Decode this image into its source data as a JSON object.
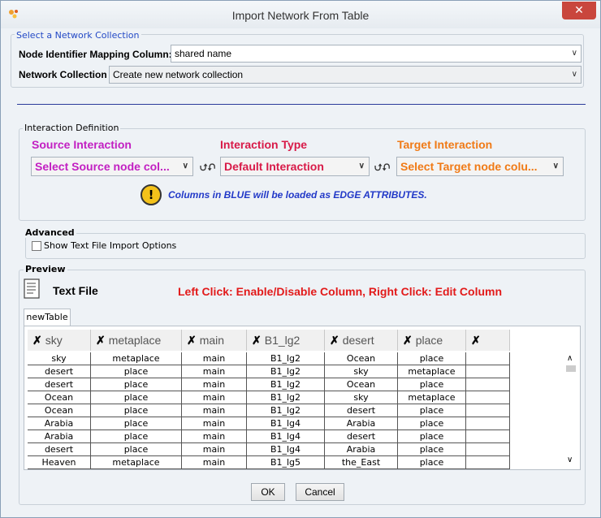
{
  "window": {
    "title": "Import Network From Table",
    "close_label": "✕"
  },
  "network_collection": {
    "legend": "Select a Network Collection",
    "node_mapping_label": "Node Identifier Mapping Column:",
    "node_mapping_value": "shared name",
    "collection_label": "Network Collection",
    "collection_value": "Create new network collection"
  },
  "interaction": {
    "legend": "Interaction Definition",
    "source_title": "Source Interaction",
    "source_value": "Select Source node col...",
    "type_title": "Interaction Type",
    "type_value": "Default Interaction",
    "target_title": "Target Interaction",
    "target_value": "Select Target node colu...",
    "warning": "Columns in BLUE will be loaded as EDGE ATTRIBUTES.",
    "colors": {
      "source": "#c21fc2",
      "type": "#d81a48",
      "target": "#f07a16"
    }
  },
  "advanced": {
    "legend": "Advanced",
    "show_options_label": "Show Text File Import Options"
  },
  "preview": {
    "legend": "Preview",
    "file_type": "Text File",
    "hint": "Left Click: Enable/Disable Column, Right Click: Edit Column",
    "tab": "newTable",
    "columns": [
      "sky",
      "metaplace",
      "main",
      "B1_lg2",
      "desert",
      "place",
      ""
    ],
    "rows": [
      [
        "sky",
        "metaplace",
        "main",
        "B1_lg2",
        "Ocean",
        "place",
        ""
      ],
      [
        "desert",
        "place",
        "main",
        "B1_lg2",
        "sky",
        "metaplace",
        ""
      ],
      [
        "desert",
        "place",
        "main",
        "B1_lg2",
        "Ocean",
        "place",
        ""
      ],
      [
        "Ocean",
        "place",
        "main",
        "B1_lg2",
        "sky",
        "metaplace",
        ""
      ],
      [
        "Ocean",
        "place",
        "main",
        "B1_lg2",
        "desert",
        "place",
        ""
      ],
      [
        "Arabia",
        "place",
        "main",
        "B1_lg4",
        "Arabia",
        "place",
        ""
      ],
      [
        "Arabia",
        "place",
        "main",
        "B1_lg4",
        "desert",
        "place",
        ""
      ],
      [
        "desert",
        "place",
        "main",
        "B1_lg4",
        "Arabia",
        "place",
        ""
      ],
      [
        "Heaven",
        "metaplace",
        "main",
        "B1_lg5",
        "the_East",
        "place",
        ""
      ]
    ]
  },
  "buttons": {
    "ok": "OK",
    "cancel": "Cancel"
  }
}
